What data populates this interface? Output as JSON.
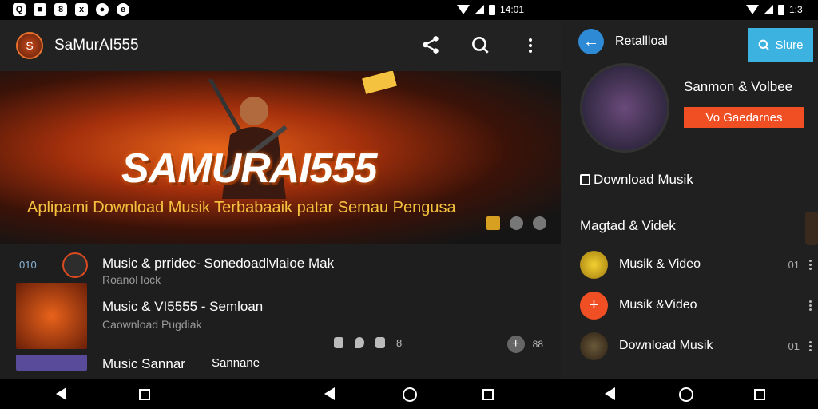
{
  "status": {
    "time_left": "14:01",
    "time_right": "1:3"
  },
  "app": {
    "title": "SaMurAI555",
    "logo_text": "S"
  },
  "banner": {
    "title": "SAMURAI555",
    "subtitle": "Aplipami Download Musik Terbabaaik patar Semau Pengusa"
  },
  "list": {
    "row1": {
      "num": "010",
      "title": "Music & prridec- Sonedoadlvlaioe Mak",
      "sub": "Roanol lock"
    },
    "row2": {
      "title": "Music & VI5555 - Semloan",
      "sub": "Caownload Pugdiak",
      "count": "8"
    },
    "row3": {
      "title": "Music Sannar",
      "title2": "Sannane"
    }
  },
  "side": {
    "title": "Retallloal",
    "save_label": "Slure",
    "profile_name": "Sanmon & Volbee",
    "subscribe_label": "Vo Gaedarnes",
    "download_label": "Download Musik",
    "section_label": "Magtad & Videk",
    "items": [
      {
        "label": "Musik & Video",
        "count": "01"
      },
      {
        "label": "Musik &Video",
        "count": ""
      },
      {
        "label": "Download Musik",
        "count": "01"
      }
    ]
  },
  "colors": {
    "accent": "#3bb2e0",
    "subscribe": "#f04e23",
    "banner_sub": "#f4c23e"
  }
}
